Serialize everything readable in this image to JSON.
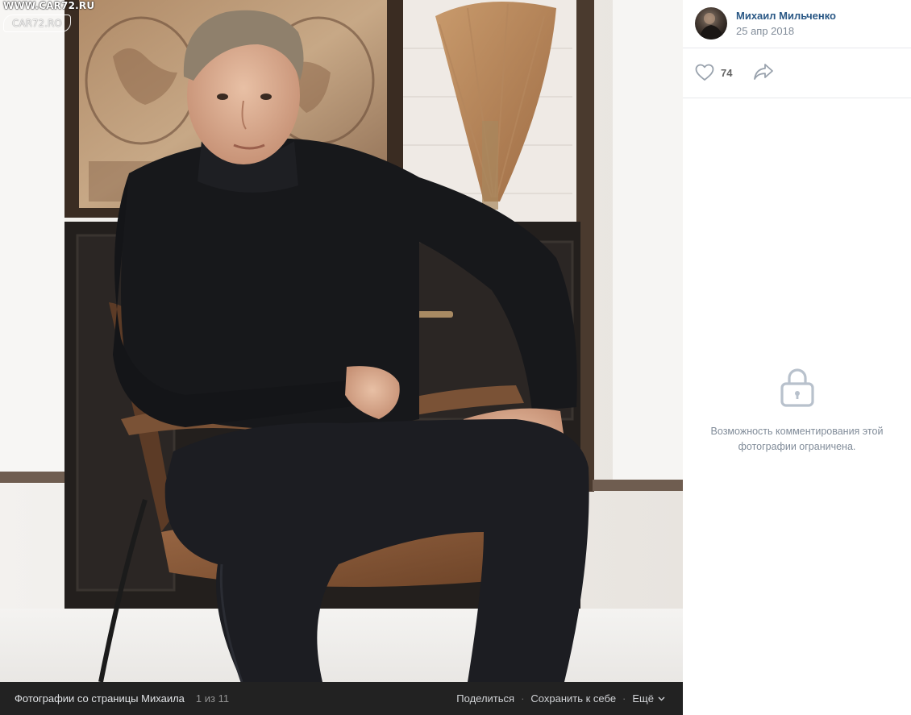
{
  "watermark": {
    "url": "WWW.CAR72.RU",
    "logo": "CAR72.RO"
  },
  "photo": {
    "subject": "Portrait of a man in a black turtleneck sitting in a leather chair"
  },
  "photo_bar": {
    "album_title": "Фотографии со страницы Михаила",
    "counter": "1 из 11",
    "share_label": "Поделиться",
    "save_label": "Сохранить к себе",
    "more_label": "Ещё",
    "separator": "·"
  },
  "author": {
    "name": "Михаил Мильченко",
    "date": "25 апр 2018"
  },
  "actions": {
    "like_count": "74",
    "like_icon": "heart-icon",
    "share_icon": "share-arrow-icon"
  },
  "comments": {
    "lock_icon": "lock-icon",
    "closed_text": "Возможность комментирования этой фотографии ограничена."
  },
  "colors": {
    "link": "#2a5885",
    "muted": "#818c99",
    "bar_bg": "#222222",
    "icon": "#99a2ad"
  }
}
